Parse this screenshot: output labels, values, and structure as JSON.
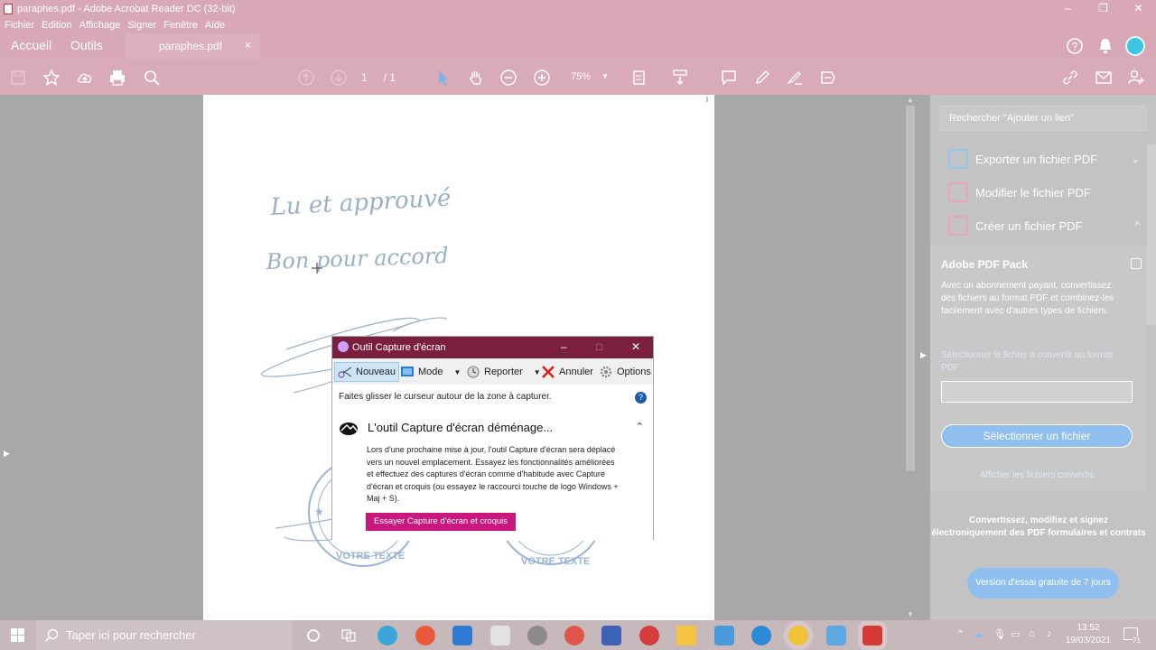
{
  "window": {
    "title": "paraphes.pdf - Adobe Acrobat Reader DC (32-bit)",
    "minimize": "–",
    "maximize": "❐",
    "close": "✕"
  },
  "menu": [
    "Fichier",
    "Edition",
    "Affichage",
    "Signer",
    "Fenêtre",
    "Aide"
  ],
  "tabs": {
    "home": "Accueil",
    "tools": "Outils",
    "document": "paraphes.pdf",
    "close": "×"
  },
  "toolbar": {
    "page_current": "1",
    "page_total": "/ 1",
    "zoom": "75%"
  },
  "right_panel": {
    "search_placeholder": "Rechercher \"Ajouter un lien\"",
    "tools": [
      {
        "label": "Exporter un fichier PDF",
        "chevron": "⌄"
      },
      {
        "label": "Modifier le fichier PDF",
        "chevron": ""
      },
      {
        "label": "Créer un fichier PDF",
        "chevron": "^"
      }
    ],
    "pack": {
      "title": "Adobe PDF Pack",
      "description": "Avec un abonnement payant, convertissez des fichiers au format PDF et combinez-les facilement avec d'autres types de fichiers.",
      "select_label": "Sélectionner le fichier à convertir au format PDF",
      "select_button": "Sélectionner un fichier",
      "show_link": "Afficher les fichiers convertis"
    },
    "promo": "Convertissez, modifiez et signez électroniquement des PDF formulaires et contrats",
    "trial_button": "Version d'essai gratuite de 7 jours"
  },
  "snipping_tool": {
    "title": "Outil Capture d'écran",
    "tools": {
      "new": "Nouveau",
      "mode": "Mode",
      "delay": "Reporter",
      "cancel": "Annuler",
      "options": "Options"
    },
    "hint": "Faites glisser le curseur autour de la zone à capturer.",
    "help": "?",
    "banner_title": "L'outil Capture d'écran déménage...",
    "banner_body": "Lors d'une prochaine mise à jour, l'outil Capture d'écran sera déplacé vers un nouvel emplacement. Essayez les fonctionnalités améliorées et effectuez des captures d'écran comme d'habitude avec Capture d'écran et croquis (ou essayez le raccourci touche de logo Windows + Maj + S).",
    "banner_button": "Essayer Capture d'écran et croquis"
  },
  "document": {
    "line1": "Lu et approuvé",
    "line2": "Bon pour accord",
    "stamp_text": "VOTRE TEXTE"
  },
  "taskbar": {
    "search_placeholder": "Taper ici pour rechercher",
    "time": "13:52",
    "date": "19/03/2021",
    "notifications": "71"
  }
}
